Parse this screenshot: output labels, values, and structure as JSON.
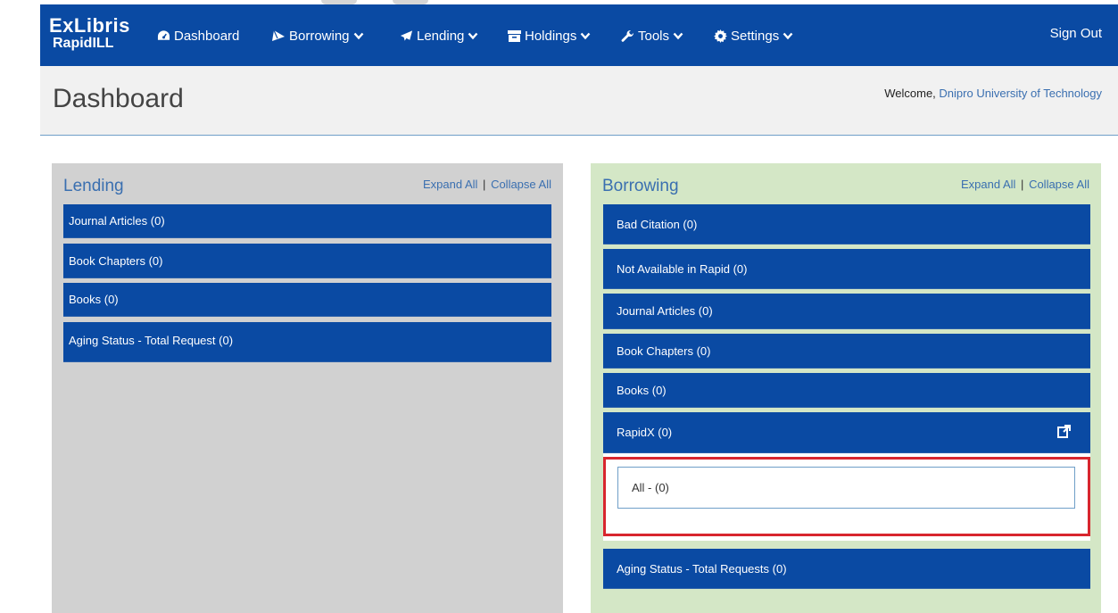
{
  "navbar": {
    "logo_line1": "ExLibris",
    "logo_line2": "RapidILL",
    "items": [
      {
        "label": "Dashboard",
        "icon": "dashboard-icon",
        "has_caret": false
      },
      {
        "label": "Borrowing",
        "icon": "borrowing-icon",
        "has_caret": true
      },
      {
        "label": "Lending",
        "icon": "paper-plane-icon",
        "has_caret": true
      },
      {
        "label": "Holdings",
        "icon": "archive-icon",
        "has_caret": true
      },
      {
        "label": "Tools",
        "icon": "wrench-icon",
        "has_caret": true
      },
      {
        "label": "Settings",
        "icon": "gear-icon",
        "has_caret": true
      }
    ],
    "sign_out": "Sign Out"
  },
  "header": {
    "title": "Dashboard",
    "welcome_prefix": "Welcome,",
    "institution": "Dnipro University of Technology"
  },
  "lending": {
    "title": "Lending",
    "expand_all": "Expand All",
    "separator": "|",
    "collapse_all": "Collapse All",
    "items": [
      "Journal Articles (0)",
      "Book Chapters (0)",
      "Books (0)",
      "Aging Status - Total Request (0)"
    ]
  },
  "borrowing": {
    "title": "Borrowing",
    "expand_all": "Expand All",
    "separator": "|",
    "collapse_all": "Collapse All",
    "items": [
      "Bad Citation (0)",
      "Not Available in Rapid (0)",
      "Journal Articles (0)",
      "Book Chapters (0)",
      "Books (0)",
      "RapidX (0)",
      "Aging Status - Total Requests (0)"
    ],
    "rapidx_sub_items": [
      "All - (0)"
    ]
  },
  "colors": {
    "navbar": "#0a4aa3",
    "lending_panel": "#d1d1d1",
    "borrowing_panel": "#d4e7c6",
    "highlight": "#d8262e",
    "link": "#3a6fb0"
  }
}
